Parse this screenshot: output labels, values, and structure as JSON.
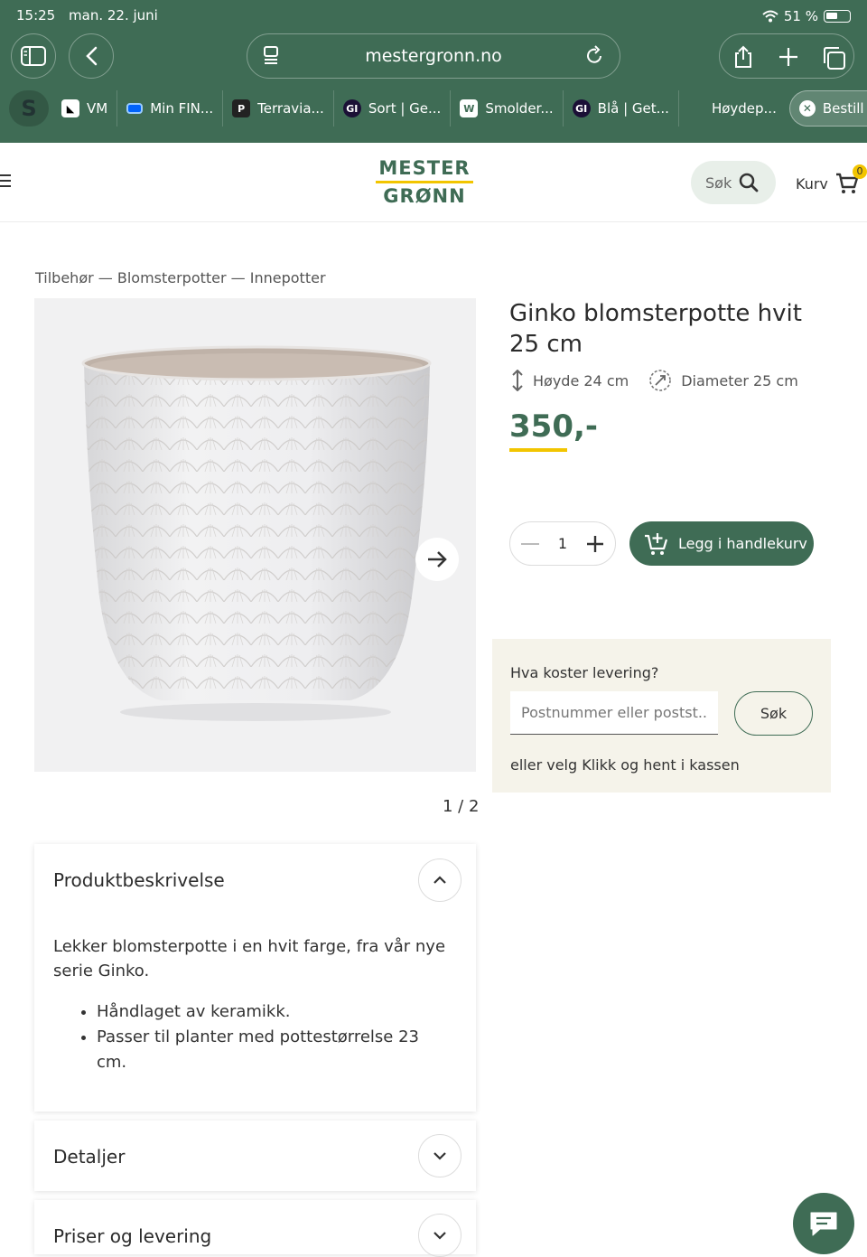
{
  "status_bar": {
    "time": "15:25",
    "date": "man. 22. juni",
    "battery": "51 %"
  },
  "browser": {
    "url": "mestergronn.no",
    "tabs": [
      {
        "label": "VM",
        "icon": "vm-favicon"
      },
      {
        "label": "Min FIN...",
        "icon": "finn-favicon"
      },
      {
        "label": "Terravia...",
        "icon": "p-favicon"
      },
      {
        "label": "Sort | Ge...",
        "icon": "gi-favicon"
      },
      {
        "label": "Smolder...",
        "icon": "w-favicon"
      },
      {
        "label": "Blå | Get...",
        "icon": "gi-favicon"
      },
      {
        "label": "Høydep...",
        "icon": "none"
      },
      {
        "label": "Bestill G...",
        "icon": "close-icon"
      }
    ],
    "first_tab_letter": "S"
  },
  "header": {
    "logo_line1": "MESTER",
    "logo_line2": "GRØNN",
    "search_label": "Søk",
    "cart_label": "Kurv",
    "cart_count": "0"
  },
  "breadcrumb": "Tilbehør — Blomsterpotter — Innepotter",
  "product": {
    "title": "Ginko blomsterpotte hvit 25 cm",
    "height": "Høyde 24 cm",
    "diameter": "Diameter 25 cm",
    "price": "350,-",
    "quantity": "1",
    "add_to_cart": "Legg i handlekurv",
    "image_counter": "1 / 2"
  },
  "delivery": {
    "question": "Hva koster levering?",
    "placeholder": "Postnummer eller postst...",
    "search_button": "Søk",
    "alternative": "eller velg Klikk og hent i kassen"
  },
  "sections": {
    "description_title": "Produktbeskrivelse",
    "description_text": "Lekker blomsterpotte i en hvit farge, fra vår nye serie Ginko.",
    "bullets": [
      "Håndlaget av keramikk.",
      "Passer til planter med pottestørrelse 23 cm."
    ],
    "details_title": "Detaljer",
    "pricing_title": "Priser og levering"
  },
  "colors": {
    "brand_green": "#3f6c55",
    "accent_yellow": "#f2c500",
    "delivery_bg": "#f5f3ea"
  }
}
